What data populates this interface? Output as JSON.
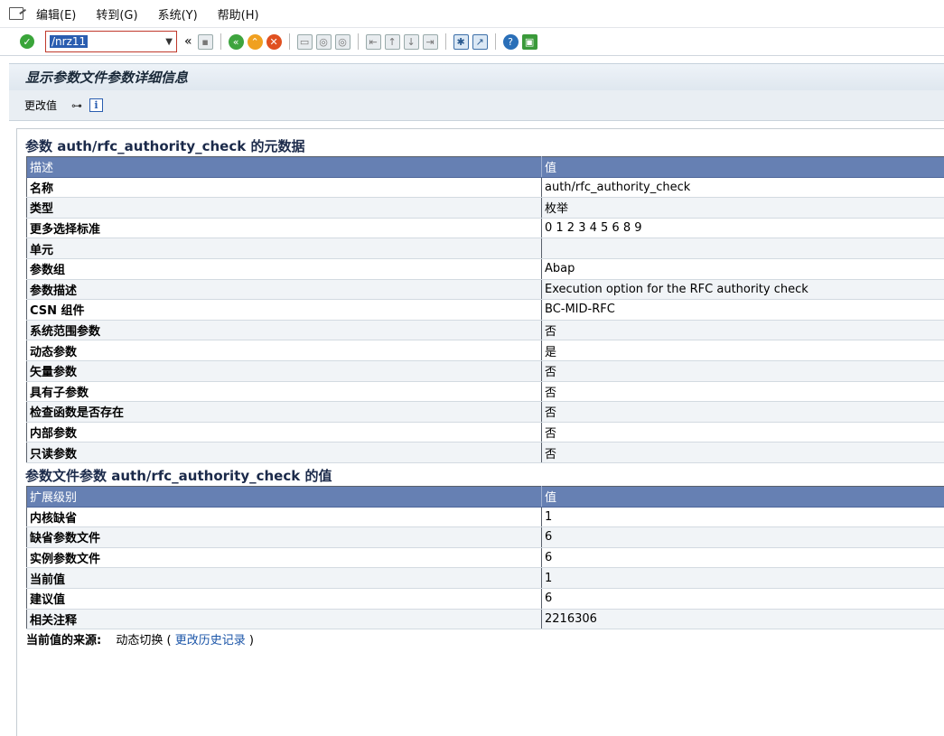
{
  "menu": {
    "items": [
      "编辑(E)",
      "转到(G)",
      "系统(Y)",
      "帮助(H)"
    ]
  },
  "toolbar": {
    "command_value": "/nrz11",
    "history_symbol": "«"
  },
  "title": "显示参数文件参数详细信息",
  "app_toolbar": {
    "change_label": "更改值"
  },
  "metadata": {
    "heading": "参数 auth/rfc_authority_check 的元数据",
    "col1": "描述",
    "col2": "值",
    "rows": [
      {
        "k": "名称",
        "v": "auth/rfc_authority_check"
      },
      {
        "k": "类型",
        "v": "枚举"
      },
      {
        "k": "更多选择标准",
        "v": "0 1 2 3 4 5 6 8 9"
      },
      {
        "k": "单元",
        "v": ""
      },
      {
        "k": "参数组",
        "v": "Abap"
      },
      {
        "k": "参数描述",
        "v": "Execution option for the RFC authority check"
      },
      {
        "k": "CSN 组件",
        "v": "BC-MID-RFC"
      },
      {
        "k": "系统范围参数",
        "v": "否"
      },
      {
        "k": "动态参数",
        "v": "是"
      },
      {
        "k": "矢量参数",
        "v": "否"
      },
      {
        "k": "具有子参数",
        "v": "否"
      },
      {
        "k": "检查函数是否存在",
        "v": "否"
      },
      {
        "k": "内部参数",
        "v": "否"
      },
      {
        "k": "只读参数",
        "v": "否"
      }
    ]
  },
  "values": {
    "heading": "参数文件参数 auth/rfc_authority_check 的值",
    "col1": "扩展级别",
    "col2": "值",
    "rows": [
      {
        "k": "内核缺省",
        "v": "1"
      },
      {
        "k": "缺省参数文件",
        "v": "6"
      },
      {
        "k": "实例参数文件",
        "v": "6"
      },
      {
        "k": "当前值",
        "v": "1"
      },
      {
        "k": "建议值",
        "v": "6"
      },
      {
        "k": "相关注释",
        "v": "2216306"
      }
    ]
  },
  "footer": {
    "label": "当前值的来源:",
    "source": "动态切换",
    "open_paren": "(",
    "link": "更改历史记录",
    "close_paren": ")"
  }
}
